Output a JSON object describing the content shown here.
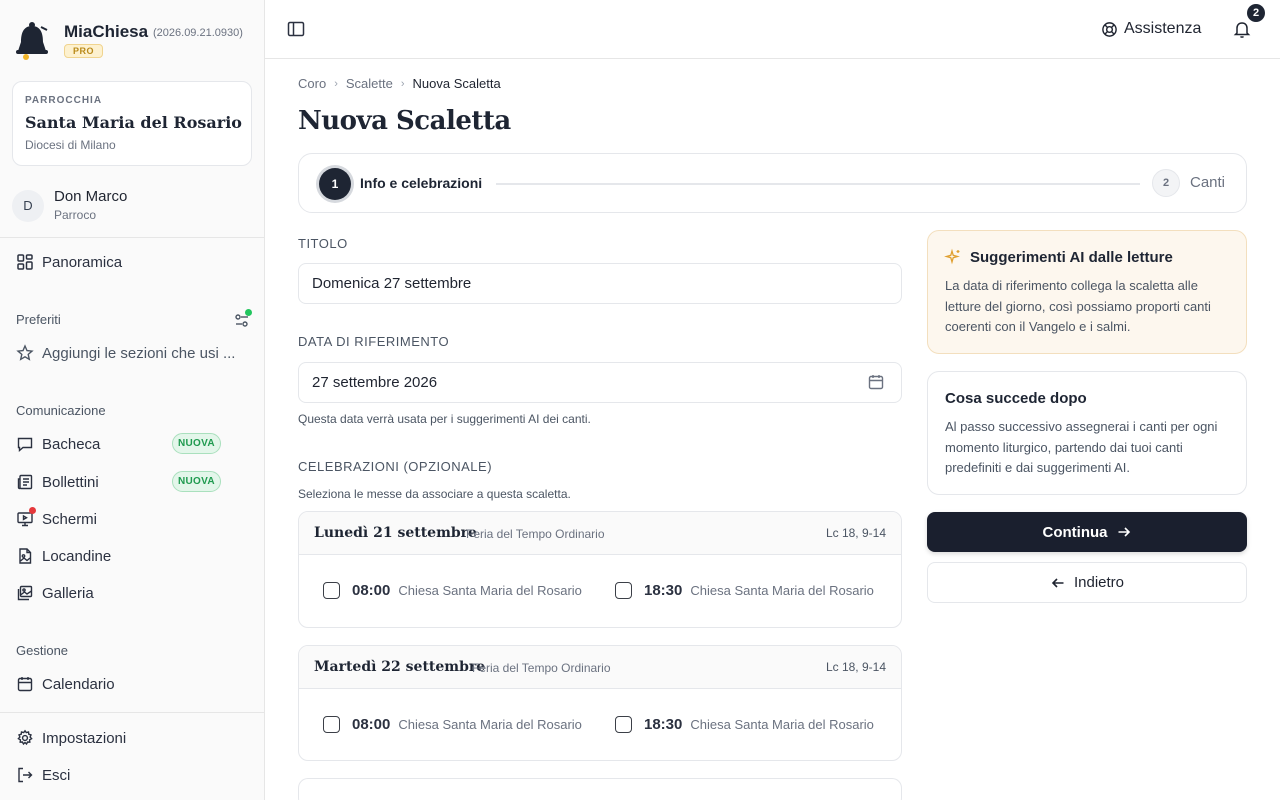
{
  "app": {
    "name": "MiaChiesa",
    "version": "(2026.09.21.0930)",
    "plan": "PRO"
  },
  "parish": {
    "label": "PARROCCHIA",
    "name": "Santa Maria del Rosario",
    "diocese": "Diocesi di Milano"
  },
  "user": {
    "initial": "D",
    "name": "Don Marco",
    "role": "Parroco"
  },
  "sidebar": {
    "overview": "Panoramica",
    "favorites_label": "Preferiti",
    "favorites_empty": "Aggiungi le sezioni che usi ...",
    "communication_label": "Comunicazione",
    "communication": [
      {
        "label": "Bacheca",
        "badge": "NUOVA"
      },
      {
        "label": "Bollettini",
        "badge": "NUOVA"
      },
      {
        "label": "Schermi"
      },
      {
        "label": "Locandine"
      },
      {
        "label": "Galleria"
      }
    ],
    "management_label": "Gestione",
    "calendar": "Calendario",
    "settings": "Impostazioni",
    "logout": "Esci"
  },
  "topbar": {
    "help": "Assistenza",
    "notifications": "2"
  },
  "breadcrumb": [
    "Coro",
    "Scalette",
    "Nuova Scaletta"
  ],
  "page_title": "Nuova Scaletta",
  "stepper": [
    {
      "num": "1",
      "label": "Info e celebrazioni",
      "active": true
    },
    {
      "num": "2",
      "label": "Canti",
      "active": false
    }
  ],
  "form": {
    "title_label": "TITOLO",
    "title_value": "Domenica 27 settembre",
    "date_label": "DATA DI RIFERIMENTO",
    "date_value": "27 settembre 2026",
    "date_hint": "Questa data verrà usata per i suggerimenti AI dei canti.",
    "celebrations_label": "CELEBRAZIONI (OPZIONALE)",
    "celebrations_hint": "Seleziona le messe da associare a questa scaletta."
  },
  "days": [
    {
      "name": "Lunedì 21 settembre",
      "feria": "Feria del Tempo Ordinario",
      "reading": "Lc 18, 9-14",
      "masses": [
        {
          "time": "08:00",
          "place": "Chiesa Santa Maria del Rosario"
        },
        {
          "time": "18:30",
          "place": "Chiesa Santa Maria del Rosario"
        }
      ]
    },
    {
      "name": "Martedì 22 settembre",
      "feria": "Feria del Tempo Ordinario",
      "reading": "Lc 18, 9-14",
      "masses": [
        {
          "time": "08:00",
          "place": "Chiesa Santa Maria del Rosario"
        },
        {
          "time": "18:30",
          "place": "Chiesa Santa Maria del Rosario"
        }
      ]
    }
  ],
  "ai_card": {
    "title": "Suggerimenti AI dalle letture",
    "body": "La data di riferimento collega la scaletta alle letture del giorno, così possiamo proporti canti coerenti con il Vangelo e i salmi."
  },
  "next_card": {
    "title": "Cosa succede dopo",
    "body": "Al passo successivo assegnerai i canti per ogni momento liturgico, partendo dai tuoi canti predefiniti e dai suggerimenti AI."
  },
  "buttons": {
    "continue": "Continua",
    "back": "Indietro"
  },
  "colors": {
    "primary": "#1a1f2e",
    "badge_green": "#1f9a4f",
    "ai_card_bg": "#fdf7ee",
    "notification_dot": "#e5383b"
  }
}
